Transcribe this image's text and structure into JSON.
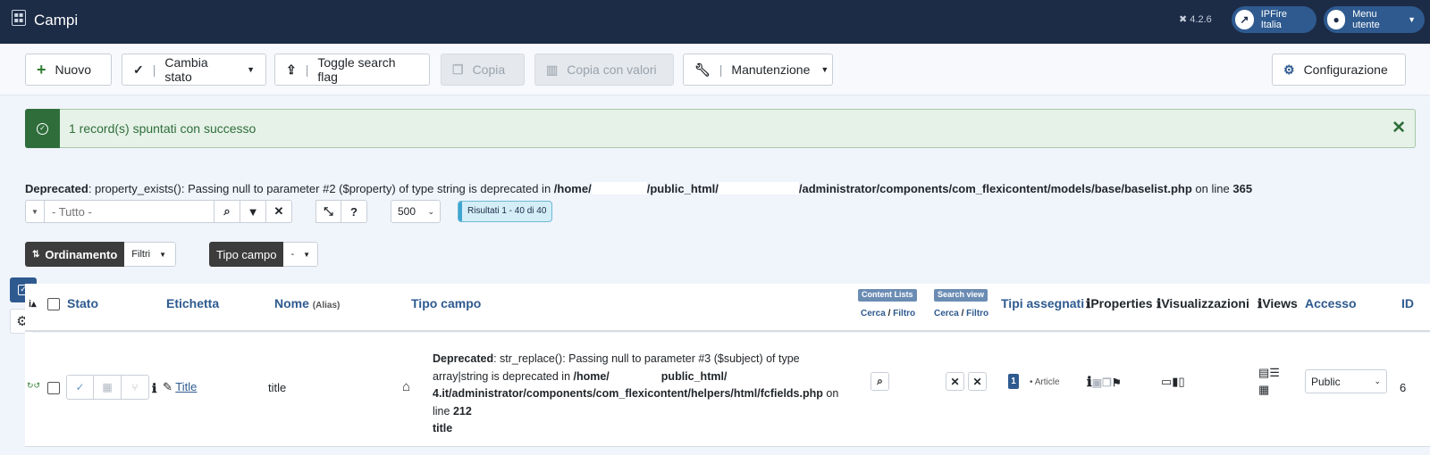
{
  "header": {
    "title": "Campi",
    "version": "4.2.6",
    "site_label": "IPFire Italia",
    "user_menu_label": "Menu utente"
  },
  "toolbar": {
    "new_label": "Nuovo",
    "change_state_label": "Cambia stato",
    "toggle_search_label": "Toggle search flag",
    "copy_label": "Copia",
    "copy_values_label": "Copia con valori",
    "maintenance_label": "Manutenzione",
    "config_label": "Configurazione"
  },
  "alert": {
    "message": "1 record(s) spuntati con successo",
    "color": "#2f6e3b"
  },
  "deprecated_notice": {
    "prefix": "Deprecated",
    "text": ": property_exists(): Passing null to parameter #2 ($property) of type string is deprecated in ",
    "path_part1": "/home/",
    "path_part2": "/public_html/",
    "path_part3": "/administrator/components/com_flexicontent/models/base/baselist.php",
    "on_line": " on line ",
    "line": "365"
  },
  "filters": {
    "search_placeholder": "- Tutto -",
    "limit_value": "500",
    "results_label": "Risultati 1 - 40 di 40",
    "ordering_label": "Ordinamento",
    "ordering_value": "Filtri",
    "field_type_label": "Tipo campo",
    "field_type_value": "-"
  },
  "table": {
    "columns": {
      "state": "Stato",
      "label": "Etichetta",
      "name": "Nome",
      "name_alias": "(Alias)",
      "field_type": "Tipo campo",
      "content_lists_badge": "Content Lists",
      "search_view_badge": "Search view",
      "cerca": "Cerca",
      "slash": " / ",
      "filtro": "Filtro",
      "assigned_types": "Tipi assegnati",
      "properties": "Properties",
      "displays": "Visualizzazioni",
      "views": "Views",
      "access": "Accesso",
      "id": "ID"
    },
    "rows": [
      {
        "label": "Title",
        "name": "title",
        "deprecated_prefix": "Deprecated",
        "deprecated_text": ": str_replace(): Passing null to parameter #3 ($subject) of type array|string is deprecated in ",
        "path_a": "/home/",
        "path_b": "public_html/",
        "path_c": "4.it/administrator/components/com_flexicontent/helpers/html/fcfields.php",
        "on_word": " on",
        "line_word": "line ",
        "line_number": "212",
        "field_type_value": "title",
        "assigned_count": "1",
        "assigned_type": "Article",
        "access": "Public",
        "id": "6"
      }
    ]
  },
  "colors": {
    "header_bg": "#1c2b46",
    "accent": "#2e5a8f",
    "success": "#2f6e3b"
  }
}
